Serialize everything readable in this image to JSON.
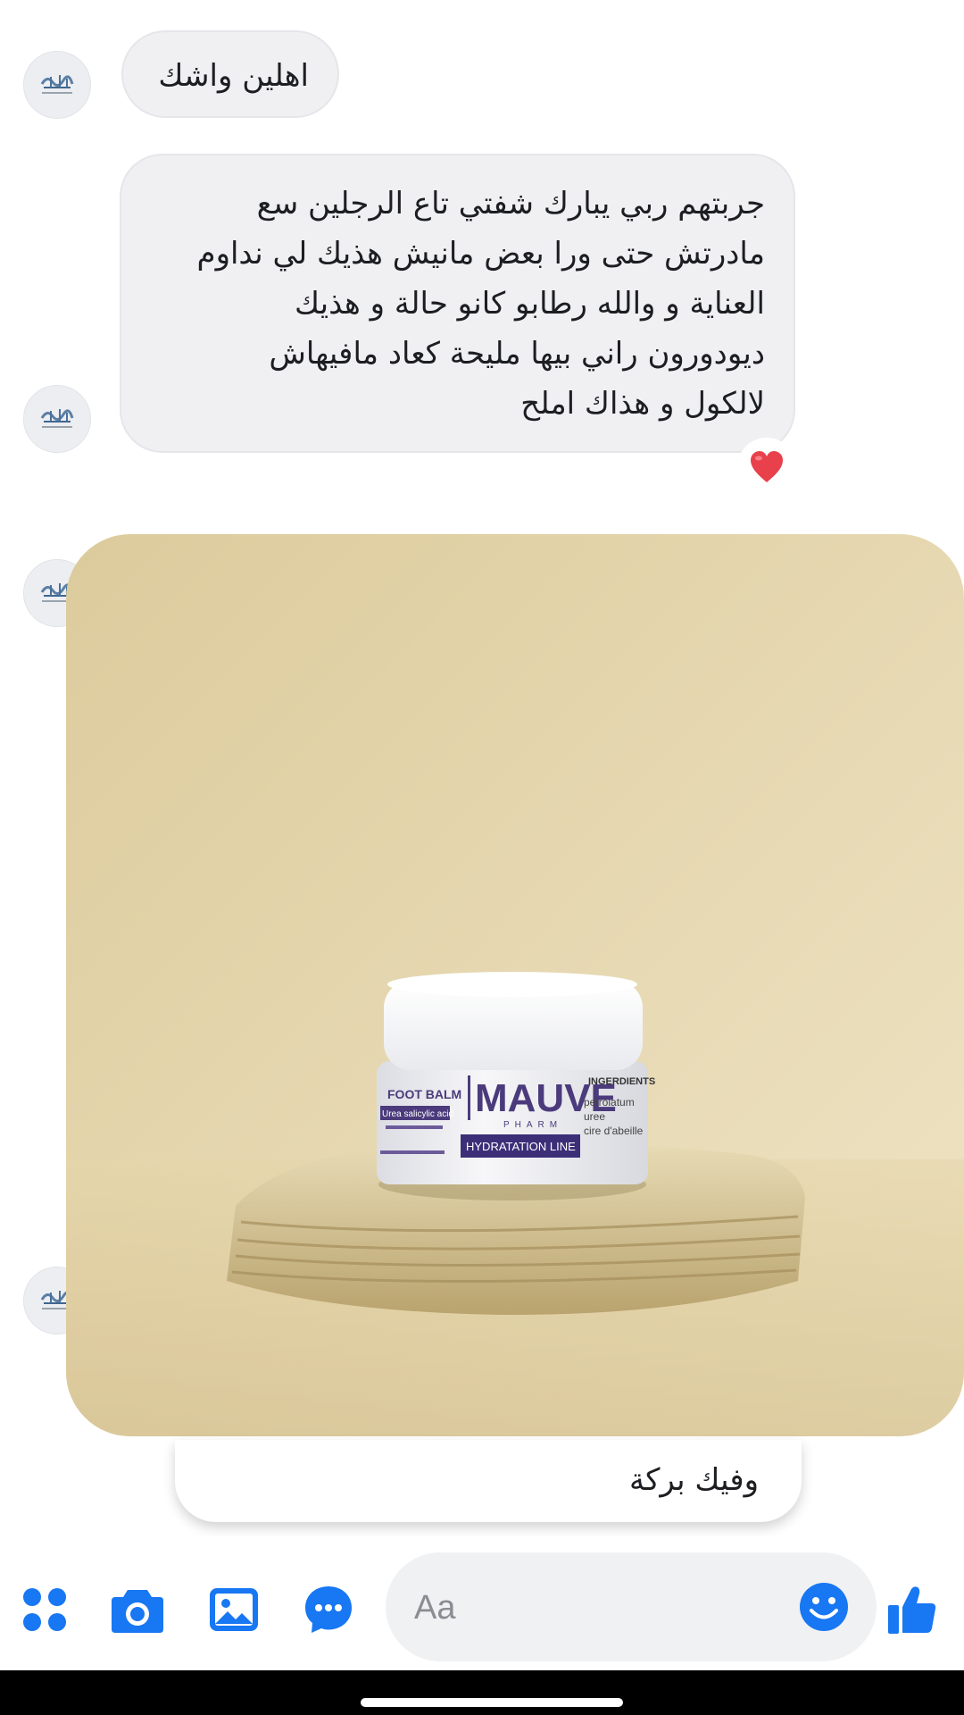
{
  "conversation": {
    "messages": [
      {
        "id": "m1",
        "text": "اهلين واشك"
      },
      {
        "id": "m2",
        "lines": [
          "جربتهم ربي يبارك شفتي تاع الرجلين سع",
          "مادرتش حتى ورا بعض مانيش هذيك لي نداوم",
          "العناية و والله رطابو كانو حالة و هذيك",
          "ديودورون راني بيها مليحة كعاد مافيهاش",
          "لالكول و هذاك املح"
        ],
        "reaction": "heart"
      }
    ],
    "photo": {
      "product": {
        "brand": "MAUVE",
        "brand_sub": "PHARM",
        "line": "HYDRATATION LINE",
        "name": "FOOT BALM",
        "tag": "Urea salicylic acid",
        "ingredients_title": "INGERDIENTS",
        "ingredients": [
          "petrolatum",
          "uree",
          "cire d'abeille"
        ]
      }
    },
    "reply": {
      "text": "وفيك بركة"
    }
  },
  "composer": {
    "placeholder": "Aa",
    "value": "",
    "icons": [
      "apps-icon",
      "camera-icon",
      "gallery-icon",
      "sticker-icon",
      "emoji-icon",
      "like-icon"
    ]
  },
  "colors": {
    "accent": "#1877f2",
    "bubble": "#f0f0f2",
    "photo_bg": "#e2d2a6",
    "reaction": "#e8414b"
  }
}
